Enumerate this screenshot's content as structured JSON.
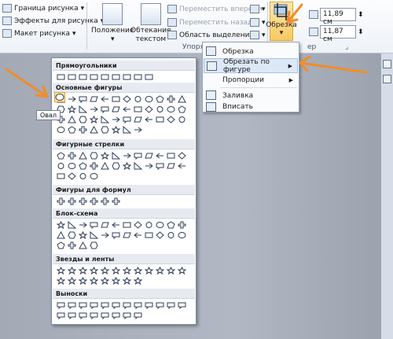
{
  "ribbon": {
    "picture_border": "Граница рисунка",
    "picture_effects": "Эффекты для рисунка",
    "picture_layout": "Макет рисунка",
    "position": "Положение",
    "text_wrap_line1": "Обтекание",
    "text_wrap_line2": "текстом",
    "bring_forward": "Переместить вперед",
    "send_backward": "Переместить назад",
    "selection_pane": "Область выделения",
    "arrange_group": "Упорядочить",
    "crop": "Обрезка",
    "height_value": "11,89 см",
    "width_value": "11,87 см",
    "size_group_tail": "ер"
  },
  "crop_menu": {
    "items": [
      "Обрезка",
      "Обрезать по фигуре",
      "Пропорции",
      "Заливка",
      "Вписать"
    ]
  },
  "gallery": {
    "sections": [
      "Прямоугольники",
      "Основные фигуры",
      "Фигурные стрелки",
      "Фигуры для формул",
      "Блок-схема",
      "Звезды и ленты",
      "Выноски"
    ]
  },
  "tooltip": "Овал",
  "colors": {
    "annotation_arrow": "#f28c28",
    "highlight": "#fde6a8"
  }
}
